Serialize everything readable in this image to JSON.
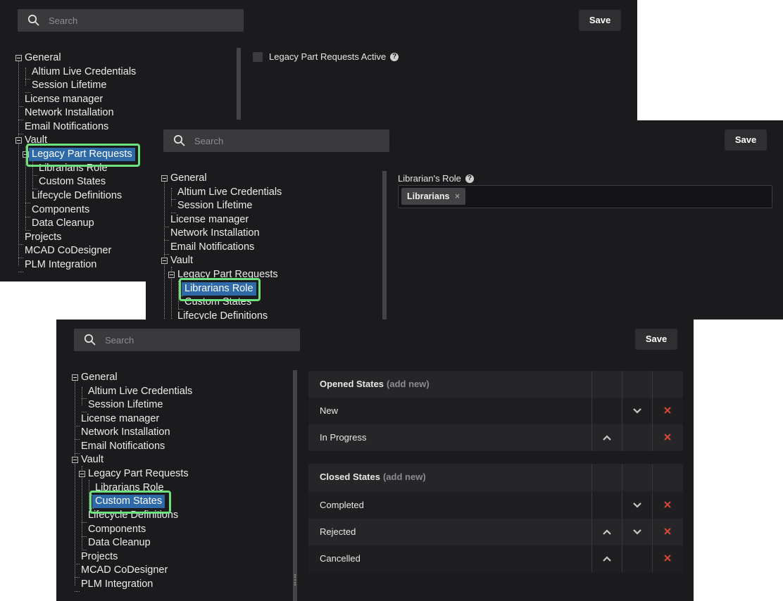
{
  "search_placeholder": "Search",
  "save_label": "Save",
  "tree_items": {
    "general": "General",
    "altium_live": "Altium Live Credentials",
    "session_lifetime": "Session Lifetime",
    "license_manager": "License manager",
    "network_installation": "Network Installation",
    "email_notifications": "Email Notifications",
    "vault": "Vault",
    "legacy_part_requests": "Legacy Part Requests",
    "librarians_role": "Librarians Role",
    "custom_states": "Custom States",
    "lifecycle_definitions": "Lifecycle Definitions",
    "components": "Components",
    "data_cleanup": "Data Cleanup",
    "projects": "Projects",
    "mcad_codesigner": "MCAD CoDesigner",
    "plm_integration": "PLM Integration"
  },
  "panel1": {
    "legacy_active_label": "Legacy Part Requests Active",
    "legacy_active_checked": false
  },
  "panel2": {
    "librarians_role_label": "Librarian's Role",
    "tag": "Librarians",
    "tag_remove": "×"
  },
  "panel3": {
    "opened_title": "Opened States",
    "closed_title": "Closed States",
    "add_new": "(add new)",
    "opened_states": [
      "New",
      "In Progress"
    ],
    "closed_states": [
      "Completed",
      "Rejected",
      "Cancelled"
    ]
  },
  "colors": {
    "panel_bg": "#1b1b1d",
    "selection": "#2e6aa8",
    "highlight_border": "#6ee07e",
    "delete_icon": "#d9463b"
  }
}
